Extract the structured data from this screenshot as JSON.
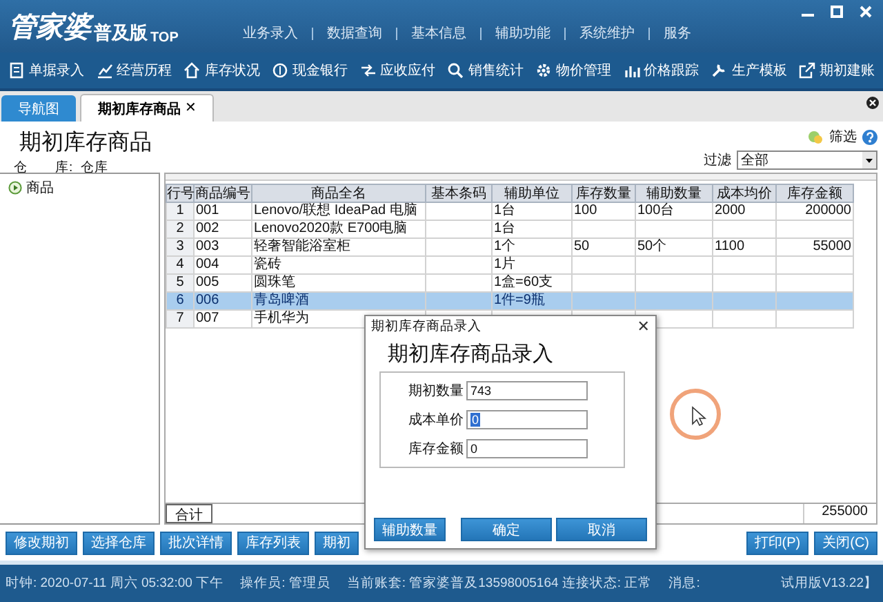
{
  "app": {
    "logo": "管家婆",
    "edition": "普及版",
    "suffix": "TOP"
  },
  "menu": [
    "业务录入",
    "数据查询",
    "基本信息",
    "辅助功能",
    "系统维护",
    "服务"
  ],
  "toolbar": [
    "单据录入",
    "经营历程",
    "库存状况",
    "现金银行",
    "应收应付",
    "销售统计",
    "物价管理",
    "价格跟踪",
    "生产模板",
    "期初建账"
  ],
  "tabs": [
    {
      "label": "导航图",
      "selected": false
    },
    {
      "label": "期初库存商品",
      "selected": true,
      "close": "✕"
    }
  ],
  "page": {
    "title": "期初库存商品",
    "warehouse_label": "仓　　库:",
    "warehouse": "仓库",
    "filter_button": "筛选",
    "filter_label": "过滤",
    "filter_value": "全部"
  },
  "tree": [
    {
      "label": "商品"
    }
  ],
  "table": {
    "columns": [
      "行号",
      "商品编号",
      "商品全名",
      "基本条码",
      "辅助单位",
      "库存数量",
      "辅助数量",
      "成本均价",
      "库存金额"
    ],
    "rows": [
      {
        "selected": false,
        "cells": [
          "1",
          "001",
          "Lenovo/联想 IdeaPad 电脑",
          "",
          "1台",
          "100",
          "100台",
          "2000",
          "200000"
        ]
      },
      {
        "selected": false,
        "cells": [
          "2",
          "002",
          "Lenovo2020款 E700电脑",
          "",
          "1台",
          "",
          "",
          "",
          ""
        ]
      },
      {
        "selected": false,
        "cells": [
          "3",
          "003",
          "轻奢智能浴室柜",
          "",
          "1个",
          "50",
          "50个",
          "1100",
          "55000"
        ]
      },
      {
        "selected": false,
        "cells": [
          "4",
          "004",
          "瓷砖",
          "",
          "1片",
          "",
          "",
          "",
          ""
        ]
      },
      {
        "selected": false,
        "cells": [
          "5",
          "005",
          "圆珠笔",
          "",
          "1盒=60支",
          "",
          "",
          "",
          ""
        ]
      },
      {
        "selected": true,
        "cells": [
          "6",
          "006",
          "青岛啤酒",
          "",
          "1件=9瓶",
          "",
          "",
          "",
          ""
        ]
      },
      {
        "selected": false,
        "cells": [
          "7",
          "007",
          "手机华为",
          "",
          "",
          "",
          "",
          "",
          ""
        ]
      }
    ],
    "footer": {
      "label": "合计",
      "total": "255000"
    }
  },
  "buttons_left": [
    "修改期初",
    "选择仓库",
    "批次详情",
    "库存列表",
    "期初"
  ],
  "buttons_right": [
    "打印(P)",
    "关闭(C)"
  ],
  "status_bar": {
    "clock": "时钟: 2020-07-11 周六 05:32:00 下午",
    "operator": "操作员: 管理员",
    "account": "当前账套: 管家婆普及13598005164 连接状态: 正常",
    "message": "消息:",
    "version": "试用版V13.22】"
  },
  "dialog": {
    "title": "期初库存商品录入",
    "close": "✕",
    "heading": "期初库存商品录入",
    "fields": [
      {
        "label": "期初数量",
        "value": "743",
        "selected": false
      },
      {
        "label": "成本单价",
        "value": "0",
        "selected": true
      },
      {
        "label": "库存金额",
        "value": "0",
        "selected": false
      }
    ],
    "buttons": [
      "辅助数量",
      "确定",
      "取消"
    ]
  }
}
